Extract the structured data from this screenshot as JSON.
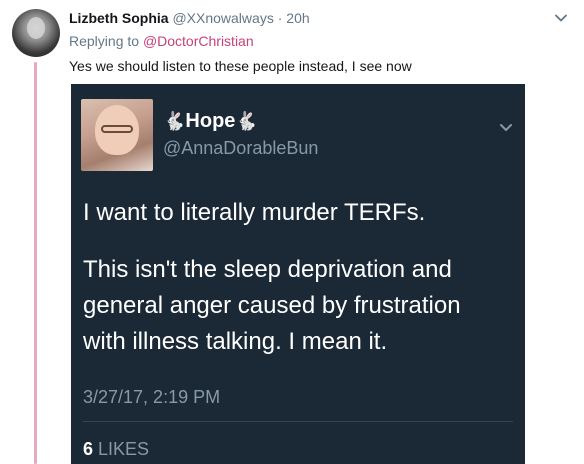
{
  "tweet": {
    "name": "Lizbeth Sophia",
    "handle": "@XXnowalways",
    "separator": "·",
    "time": "20h",
    "replying_prefix": "Replying to",
    "replying_to": "@DoctorChristian",
    "text": "Yes we should listen to these people instead, I see now"
  },
  "embed": {
    "rabbit_left": "🐇",
    "name": "Hope",
    "rabbit_right": "🐇",
    "handle": "@AnnaDorableBun",
    "para1": "I want to literally murder TERFs.",
    "para2_line1": "This isn't the sleep deprivation and",
    "para2_line2": "general anger caused by frustration",
    "para2_line3": "with illness talking. I mean it.",
    "timestamp": "3/27/17, 2:19 PM",
    "likes_count": "6",
    "likes_label": "LIKES"
  },
  "colors": {
    "thread_line": "#e5a9c0",
    "reply_link": "#c4427a",
    "embed_bg": "#1b2836"
  },
  "icons": {
    "tweet_menu": "chevron-down-icon",
    "embed_menu": "chevron-down-icon"
  }
}
